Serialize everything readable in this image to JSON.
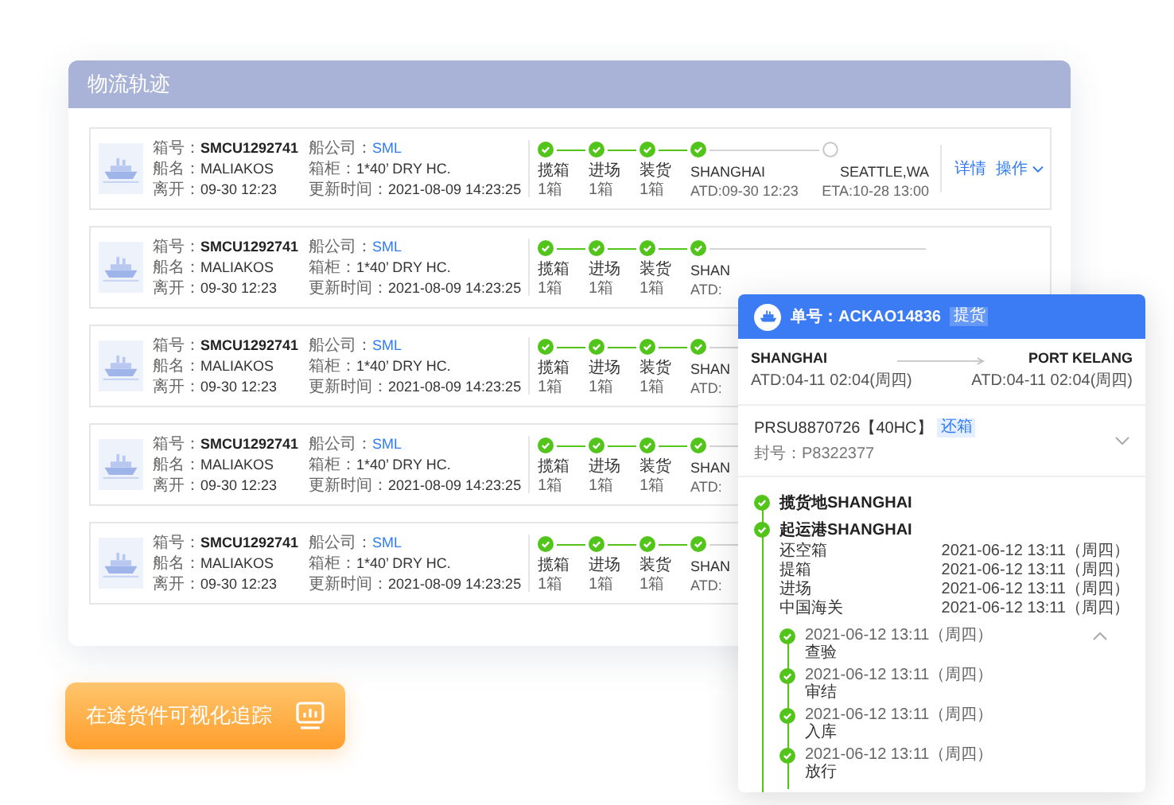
{
  "panel": {
    "title": "物流轨迹"
  },
  "shipments": [
    {
      "fields": [
        {
          "label": "箱号：",
          "value": "SMCU1292741",
          "kind": "strong"
        },
        {
          "label": "船名：",
          "value": "MALIAKOS",
          "kind": "plain"
        },
        {
          "label": "离开：",
          "value": "09-30 12:23",
          "kind": "plain"
        },
        {
          "label": "船公司：",
          "value": "SML",
          "kind": "link"
        },
        {
          "label": "箱柜：",
          "value": "1*40’  DRY HC.",
          "kind": "plain"
        },
        {
          "label": "更新时间：",
          "value": "2021-08-09 14:23:25",
          "kind": "plain"
        }
      ],
      "stages": [
        {
          "kind": "step",
          "label": "揽箱",
          "detail": "1箱",
          "done": true
        },
        {
          "kind": "step",
          "label": "进场",
          "detail": "1箱",
          "done": true
        },
        {
          "kind": "step",
          "label": "装货",
          "detail": "1箱",
          "done": true
        },
        {
          "kind": "origin",
          "label": "SHANGHAI",
          "detail": "ATD:09-30 12:23",
          "done": true
        },
        {
          "kind": "destination",
          "label": "SEATTLE,WA",
          "detail": "ETA:10-28 13:00",
          "done": false
        }
      ],
      "actions": [
        "详情",
        "操作"
      ]
    },
    {
      "fields": [
        {
          "label": "箱号：",
          "value": "SMCU1292741",
          "kind": "strong"
        },
        {
          "label": "船名：",
          "value": "MALIAKOS",
          "kind": "plain"
        },
        {
          "label": "离开：",
          "value": "09-30 12:23",
          "kind": "plain"
        },
        {
          "label": "船公司：",
          "value": "SML",
          "kind": "link"
        },
        {
          "label": "箱柜：",
          "value": "1*40’  DRY HC.",
          "kind": "plain"
        },
        {
          "label": "更新时间：",
          "value": "2021-08-09 14:23:25",
          "kind": "plain"
        }
      ],
      "stages": [
        {
          "kind": "step",
          "label": "揽箱",
          "detail": "1箱",
          "done": true
        },
        {
          "kind": "step",
          "label": "进场",
          "detail": "1箱",
          "done": true
        },
        {
          "kind": "step",
          "label": "装货",
          "detail": "1箱",
          "done": true
        },
        {
          "kind": "origin",
          "label": "SHAN",
          "detail": "ATD:",
          "done": true
        }
      ]
    },
    {
      "fields": [
        {
          "label": "箱号：",
          "value": "SMCU1292741",
          "kind": "strong"
        },
        {
          "label": "船名：",
          "value": "MALIAKOS",
          "kind": "plain"
        },
        {
          "label": "离开：",
          "value": "09-30 12:23",
          "kind": "plain"
        },
        {
          "label": "船公司：",
          "value": "SML",
          "kind": "link"
        },
        {
          "label": "箱柜：",
          "value": "1*40’  DRY HC.",
          "kind": "plain"
        },
        {
          "label": "更新时间：",
          "value": "2021-08-09 14:23:25",
          "kind": "plain"
        }
      ],
      "stages": [
        {
          "kind": "step",
          "label": "揽箱",
          "detail": "1箱",
          "done": true
        },
        {
          "kind": "step",
          "label": "进场",
          "detail": "1箱",
          "done": true
        },
        {
          "kind": "step",
          "label": "装货",
          "detail": "1箱",
          "done": true
        },
        {
          "kind": "origin",
          "label": "SHAN",
          "detail": "ATD:",
          "done": true
        }
      ]
    },
    {
      "fields": [
        {
          "label": "箱号：",
          "value": "SMCU1292741",
          "kind": "strong"
        },
        {
          "label": "船名：",
          "value": "MALIAKOS",
          "kind": "plain"
        },
        {
          "label": "离开：",
          "value": "09-30 12:23",
          "kind": "plain"
        },
        {
          "label": "船公司：",
          "value": "SML",
          "kind": "link"
        },
        {
          "label": "箱柜：",
          "value": "1*40’  DRY HC.",
          "kind": "plain"
        },
        {
          "label": "更新时间：",
          "value": "2021-08-09 14:23:25",
          "kind": "plain"
        }
      ],
      "stages": [
        {
          "kind": "step",
          "label": "揽箱",
          "detail": "1箱",
          "done": true
        },
        {
          "kind": "step",
          "label": "进场",
          "detail": "1箱",
          "done": true
        },
        {
          "kind": "step",
          "label": "装货",
          "detail": "1箱",
          "done": true
        },
        {
          "kind": "origin",
          "label": "SHAN",
          "detail": "ATD:",
          "done": true
        }
      ]
    },
    {
      "fields": [
        {
          "label": "箱号：",
          "value": "SMCU1292741",
          "kind": "strong"
        },
        {
          "label": "船名：",
          "value": "MALIAKOS",
          "kind": "plain"
        },
        {
          "label": "离开：",
          "value": "09-30 12:23",
          "kind": "plain"
        },
        {
          "label": "船公司：",
          "value": "SML",
          "kind": "link"
        },
        {
          "label": "箱柜：",
          "value": "1*40’  DRY HC.",
          "kind": "plain"
        },
        {
          "label": "更新时间：",
          "value": "2021-08-09 14:23:25",
          "kind": "plain"
        }
      ],
      "stages": [
        {
          "kind": "step",
          "label": "揽箱",
          "detail": "1箱",
          "done": true
        },
        {
          "kind": "step",
          "label": "进场",
          "detail": "1箱",
          "done": true
        },
        {
          "kind": "step",
          "label": "装货",
          "detail": "1箱",
          "done": true
        },
        {
          "kind": "origin",
          "label": "SHAN",
          "detail": "ATD:",
          "done": true
        }
      ]
    }
  ],
  "tracking_card": {
    "order": "单号：ACKAO14836",
    "order_tag": "提货",
    "origin": {
      "port": "SHANGHAI",
      "time": "ATD:04-11 02:04(周四)"
    },
    "destination": {
      "port": "PORT KELANG",
      "time": "ATD:04-11 02:04(周四)"
    },
    "container": {
      "number": "PRSU8870726【40HC】",
      "tag": "还箱",
      "seal": "封号：P8322377",
      "expanded": false
    },
    "milestones": [
      {
        "title": "揽货地SHANGHAI"
      },
      {
        "title": "起运港SHANGHAI",
        "events": [
          {
            "name": "还空箱",
            "time": "2021-06-12 13:11（周四）"
          },
          {
            "name": "提箱",
            "time": "2021-06-12 13:11（周四）"
          },
          {
            "name": "进场",
            "time": "2021-06-12 13:11（周四）"
          },
          {
            "name": "中国海关",
            "time": "2021-06-12 13:11（周四）"
          }
        ],
        "details": {
          "expanded": true,
          "items": [
            {
              "time": "2021-06-12 13:11（周四）",
              "name": "查验"
            },
            {
              "time": "2021-06-12 13:11（周四）",
              "name": "审结"
            },
            {
              "time": "2021-06-12 13:11（周四）",
              "name": "入库"
            },
            {
              "time": "2021-06-12 13:11（周四）",
              "name": "放行"
            }
          ]
        }
      }
    ]
  },
  "banner": {
    "label": "在途货件可视化追踪"
  }
}
